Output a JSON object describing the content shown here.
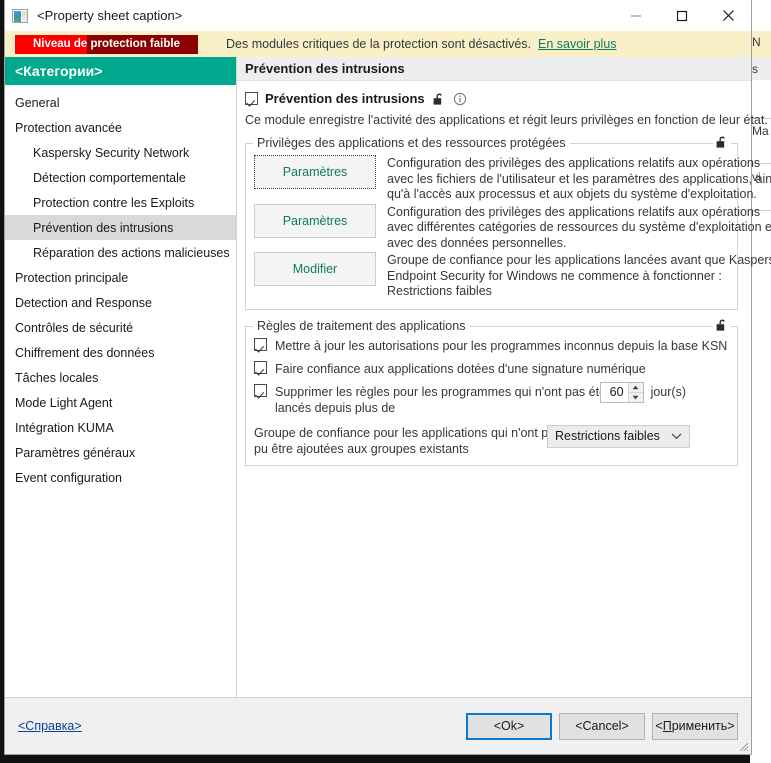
{
  "window": {
    "title": "<Property sheet caption>",
    "icon": "app-window-icon",
    "minimize": "minimize-icon",
    "maximize": "maximize-icon",
    "close": "close-icon"
  },
  "banner": {
    "status_label": "Niveau de protection faible",
    "message": "Des modules critiques de la protection sont désactivés.",
    "link": "En savoir plus",
    "bar_background": "#8b0000",
    "bar_fill": "#fa0000",
    "background": "#faf0c8",
    "link_color": "#0f7a5f"
  },
  "sidebar": {
    "header": "<Категории>",
    "header_background": "#00a88e",
    "items": [
      {
        "label": "General",
        "level": 1,
        "selected": false
      },
      {
        "label": "Protection avancée",
        "level": 1,
        "selected": false
      },
      {
        "label": "Kaspersky Security Network",
        "level": 2,
        "selected": false
      },
      {
        "label": "Détection comportementale",
        "level": 2,
        "selected": false
      },
      {
        "label": "Protection contre les Exploits",
        "level": 2,
        "selected": false
      },
      {
        "label": "Prévention des intrusions",
        "level": 2,
        "selected": true
      },
      {
        "label": "Réparation des actions malicieuses",
        "level": 2,
        "selected": false
      },
      {
        "label": "Protection principale",
        "level": 1,
        "selected": false
      },
      {
        "label": "Detection and Response",
        "level": 1,
        "selected": false
      },
      {
        "label": "Contrôles de sécurité",
        "level": 1,
        "selected": false
      },
      {
        "label": "Chiffrement des données",
        "level": 1,
        "selected": false
      },
      {
        "label": "Tâches locales",
        "level": 1,
        "selected": false
      },
      {
        "label": "Mode Light Agent",
        "level": 1,
        "selected": false
      },
      {
        "label": "Intégration KUMA",
        "level": 1,
        "selected": false
      },
      {
        "label": "Paramètres généraux",
        "level": 1,
        "selected": false
      },
      {
        "label": "Event configuration",
        "level": 1,
        "selected": false
      }
    ]
  },
  "content": {
    "header": "Prévention des intrusions",
    "module": {
      "label": "Prévention des intrusions",
      "checked": true,
      "lock_icon": "unlocked-padlock-icon",
      "info_icon": "info-circle-icon",
      "description": "Ce module enregistre l'activité des applications et régit leurs privilèges en fonction de leur état."
    },
    "group_privileges": {
      "title": "Privilèges des applications et des ressources protégées",
      "lock_icon": "unlocked-padlock-icon",
      "rows": [
        {
          "button": "Paramètres",
          "focused": true,
          "description": [
            "Configuration des privilèges des applications relatifs aux opérations",
            "avec les fichiers de l'utilisateur et les paramètres des applications, ainsi",
            "qu'à l'accès aux processus et aux objets du système d'exploitation."
          ]
        },
        {
          "button": "Paramètres",
          "focused": false,
          "description": [
            "Configuration des privilèges des applications relatifs aux opérations",
            "avec différentes catégories de ressources du système d'exploitation et",
            "avec des données personnelles."
          ]
        },
        {
          "button": "Modifier",
          "focused": false,
          "description": [
            "Groupe de confiance pour les applications lancées avant que Kaspersky",
            "Endpoint Security for Windows ne commence à fonctionner :",
            "Restrictions faibles"
          ]
        }
      ]
    },
    "group_rules": {
      "title": "Règles de traitement des applications",
      "lock_icon": "unlocked-padlock-icon",
      "checkboxes": [
        {
          "checked": true,
          "lines": [
            "Mettre à jour les autorisations pour les programmes inconnus depuis la base KSN"
          ]
        },
        {
          "checked": true,
          "lines": [
            "Faire confiance aux applications dotées d'une signature numérique"
          ]
        },
        {
          "checked": true,
          "lines": [
            "Supprimer les règles pour les programmes qui n'ont pas été",
            "lancés depuis plus de"
          ]
        }
      ],
      "spinner": {
        "value": "60",
        "unit": "jour(s)"
      },
      "trust_group": {
        "lines": [
          "Groupe de confiance pour les applications qui n'ont pas",
          "pu être ajoutées aux groupes existants"
        ],
        "selected": "Restrictions faibles",
        "options": [
          "Restrictions faibles"
        ]
      }
    }
  },
  "footer": {
    "help": "<Справка>",
    "ok": "<Ok>",
    "cancel": "<Cancel>",
    "apply_prefix": "<",
    "apply_accel": "П",
    "apply_suffix": "рименить>",
    "ok_focus_color": "#0a7ad1"
  },
  "background_window": {
    "fragments": [
      "N",
      "s",
      "Ma",
      "vi"
    ]
  }
}
